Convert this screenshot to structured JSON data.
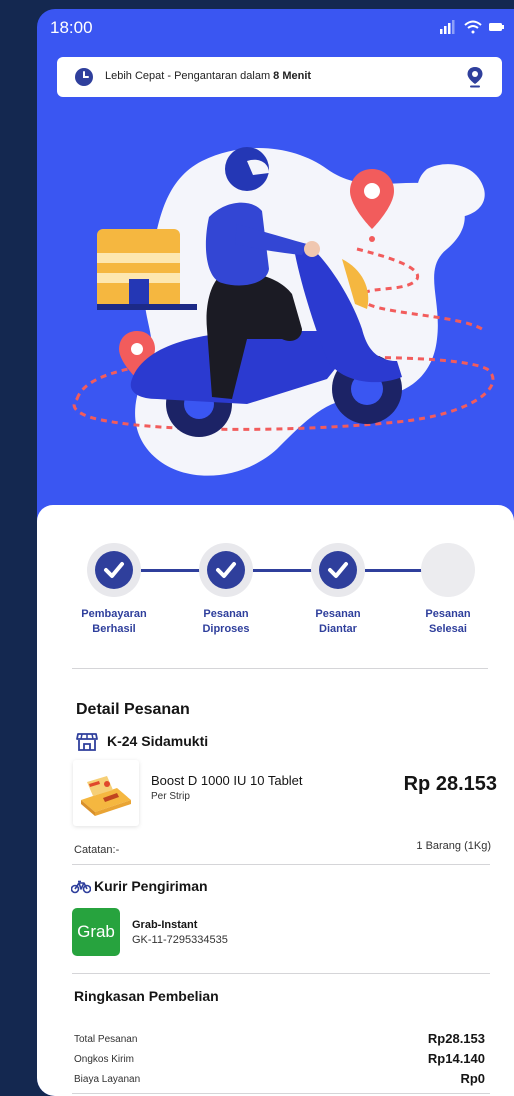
{
  "status_bar": {
    "time": "18:00"
  },
  "banner": {
    "text_prefix": "Lebih Cepat - Pengantaran dalam ",
    "text_bold": "8 Menit"
  },
  "steps": [
    {
      "label_line1": "Pembayaran",
      "label_line2": "Berhasil",
      "done": true
    },
    {
      "label_line1": "Pesanan",
      "label_line2": "Diproses",
      "done": true
    },
    {
      "label_line1": "Pesanan",
      "label_line2": "Diantar",
      "done": true
    },
    {
      "label_line1": "Pesanan",
      "label_line2": "Selesai",
      "done": false
    }
  ],
  "order": {
    "title": "Detail Pesanan",
    "store": "K-24 Sidamukti",
    "product_name": "Boost D 1000 IU 10 Tablet",
    "product_unit": "Per Strip",
    "product_price": "Rp 28.153",
    "note": "Catatan:-",
    "quantity": "1 Barang (1Kg)"
  },
  "courier": {
    "title": "Kurir Pengiriman",
    "logo_text": "Grab",
    "service": "Grab-Instant",
    "tracking_code": "GK-11-7295334535"
  },
  "summary": {
    "title": "Ringkasan Pembelian",
    "rows": [
      {
        "label": "Total Pesanan",
        "value": "Rp28.153"
      },
      {
        "label": "Ongkos Kirim",
        "value": "Rp14.140"
      },
      {
        "label": "Biaya Layanan",
        "value": "Rp0"
      }
    ]
  },
  "colors": {
    "hero_blue": "#3a56f2",
    "step_navy": "#2f3f9c",
    "grab_green": "#27a33e",
    "page_bg": "#142850"
  }
}
